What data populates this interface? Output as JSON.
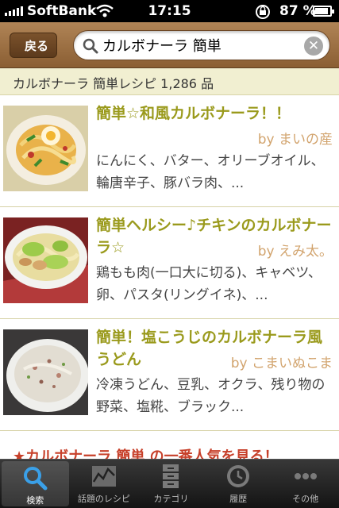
{
  "status_bar": {
    "carrier": "SoftBank",
    "time": "17:15",
    "battery_percent": "87 %",
    "battery_level": 0.87
  },
  "nav": {
    "back_label": "戻る",
    "search_value": "カルボナーラ 簡単"
  },
  "results": {
    "summary": "カルボナーラ 簡単レシピ 1,286 品"
  },
  "recipes": [
    {
      "title": "簡単☆和風カルボナーラ！！",
      "author": "by まいの産",
      "ingredients": "にんにく、バター、オリーブオイル、輪唐辛子、豚バラ肉、..."
    },
    {
      "title": "簡単ヘルシー♪チキンのカルボナーラ☆",
      "author": "by えみ太。",
      "ingredients": "鶏もも肉(一口大に切る)、キャベツ、卵、パスタ(リングイネ)、..."
    },
    {
      "title": "簡単！塩こうじのカルボナーラ風うどん",
      "author": "by こまいぬこま",
      "ingredients": "冷凍うどん、豆乳、オクラ、残り物の野菜、塩糀、ブラック..."
    }
  ],
  "promo": {
    "text": "★カルボナーラ 簡単 の一番人気を見る！"
  },
  "tabs": [
    {
      "label": "検索",
      "icon": "search-icon",
      "active": true
    },
    {
      "label": "話題のレシピ",
      "icon": "trend-chart-icon",
      "active": false
    },
    {
      "label": "カテゴリ",
      "icon": "cabinet-icon",
      "active": false
    },
    {
      "label": "履歴",
      "icon": "clock-icon",
      "active": false
    },
    {
      "label": "その他",
      "icon": "more-icon",
      "active": false
    }
  ],
  "colors": {
    "nav_brown": "#9a6e42",
    "title_olive": "#9a9a1c",
    "author_tan": "#d2a46e",
    "promo_red": "#c7402a",
    "header_cream": "#f1efd1"
  }
}
